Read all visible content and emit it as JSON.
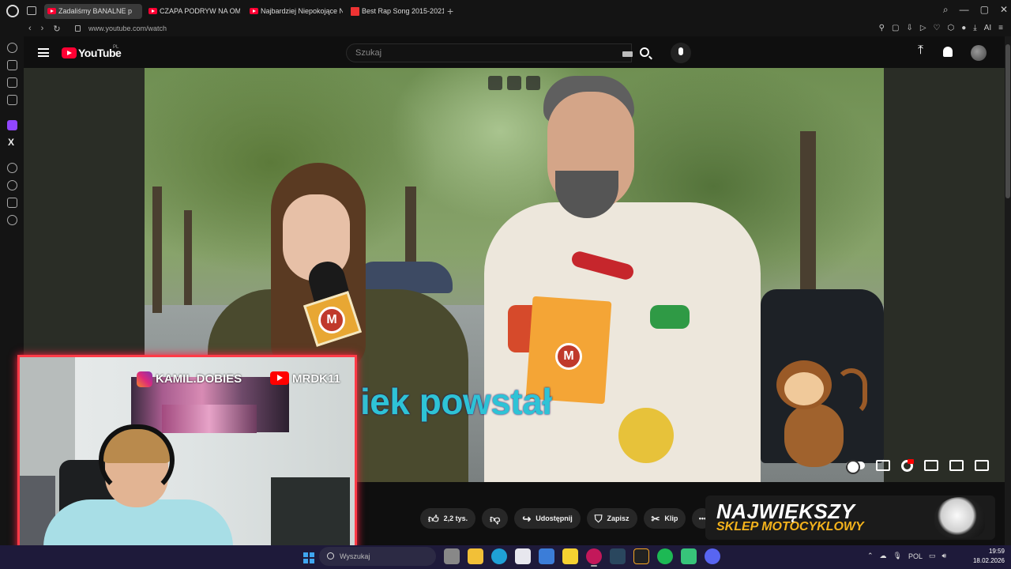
{
  "browser": {
    "tabs": [
      {
        "title": "Zadaliśmy BANALNE p",
        "active": true,
        "favicon": "youtube-icon"
      },
      {
        "title": "CZAPA PODRYW NA OME",
        "active": false,
        "favicon": "youtube-icon"
      },
      {
        "title": "Najbardziej Niepokojące N",
        "active": false,
        "favicon": "youtube-icon"
      },
      {
        "title": "Best Rap Song 2015-2021",
        "active": false,
        "favicon": "genius-icon"
      }
    ],
    "new_tab": "+",
    "url": "www.youtube.com/watch",
    "window_controls": {
      "minimize": "—",
      "maximize": "▢",
      "close": "✕"
    }
  },
  "youtube": {
    "logo_text": "YouTube",
    "region": "PL",
    "search_placeholder": "Szukaj"
  },
  "video": {
    "subtitle": "iek powstał",
    "mic_badge": "M",
    "clipboard_badge": "M"
  },
  "actions": {
    "like_count": "2,2 tys.",
    "share": "Udostępnij",
    "save": "Zapisz",
    "clip": "Klip",
    "more": "•••"
  },
  "ad": {
    "line1": "NAJWIĘKSZY",
    "line2": "SKLEP MOTOCYKLOWY"
  },
  "webcam": {
    "instagram_handle": "KAMIL.DOBIES",
    "youtube_handle": "MRDK11"
  },
  "taskbar": {
    "search_placeholder": "Wyszukaj",
    "language": "POL",
    "time": "19:59",
    "date": "18.02.2026"
  },
  "colors": {
    "youtube_red": "#ff0033",
    "subtitle_cyan": "#2ec3d6",
    "webcam_border": "#ff3b47",
    "ad_yellow": "#f4b31c"
  }
}
